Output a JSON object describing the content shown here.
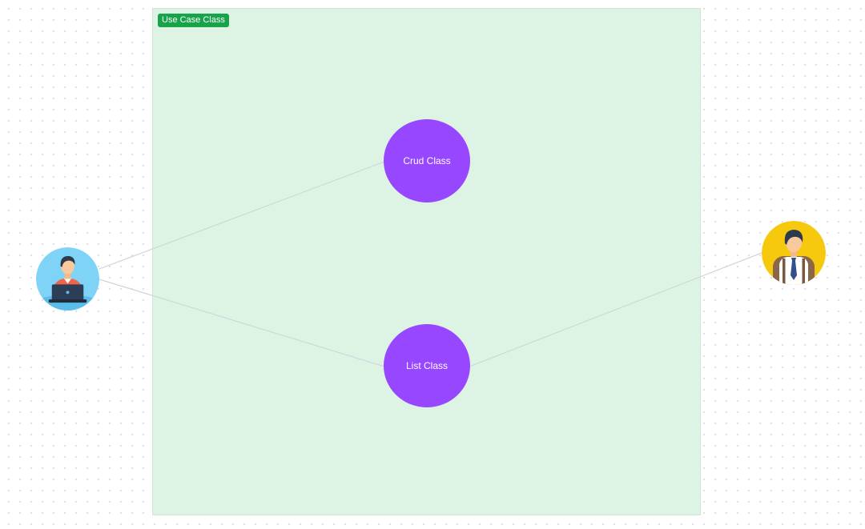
{
  "boundary": {
    "label": "Use Case Class",
    "fill_color": "#ddf3e4",
    "label_color": "#16a34a"
  },
  "use_cases": [
    {
      "id": "crud",
      "label": "Crud Class",
      "color": "#9747ff"
    },
    {
      "id": "list",
      "label": "List Class",
      "color": "#9747ff"
    }
  ],
  "actors": [
    {
      "id": "developer",
      "icon": "developer-with-laptop-icon",
      "background": "#7ed3f7"
    },
    {
      "id": "student",
      "icon": "student-with-backpack-icon",
      "background": "#f6c90e"
    }
  ],
  "connections": [
    {
      "from": "developer",
      "to": "crud"
    },
    {
      "from": "developer",
      "to": "list"
    },
    {
      "from": "student",
      "to": "list"
    }
  ]
}
